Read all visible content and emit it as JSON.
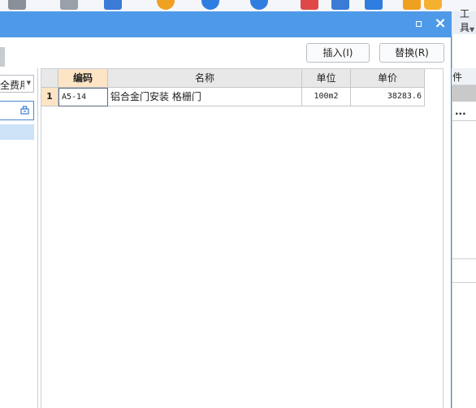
{
  "toolbar": {
    "icons": [
      "grid-icon",
      "tablet-icon",
      "list-icon",
      "refresh-coin-icon",
      "mode-icon",
      "fee-icon",
      "check-icon",
      "link-icon",
      "tree-icon",
      "bracket-icon",
      "box-icon"
    ],
    "work_label": "工具"
  },
  "dialog": {
    "insert_label": "插入(I)",
    "replace_label": "替换(R)",
    "close_glyph": "×"
  },
  "left_panel": {
    "select_value": "全费用"
  },
  "table": {
    "columns": [
      "编码",
      "名称",
      "单位",
      "单价"
    ],
    "rows": [
      {
        "num": "1",
        "code": "A5-14",
        "name": "铝合金门安装 格栅门",
        "unit": "100m2",
        "price": "38283.6"
      }
    ]
  },
  "background": {
    "header_fragment": "件",
    "ellipsis": "..."
  },
  "colors": {
    "titlebar": "#4f9ae8",
    "active_header": "#fce4c4",
    "selection": "#cde2f7"
  }
}
